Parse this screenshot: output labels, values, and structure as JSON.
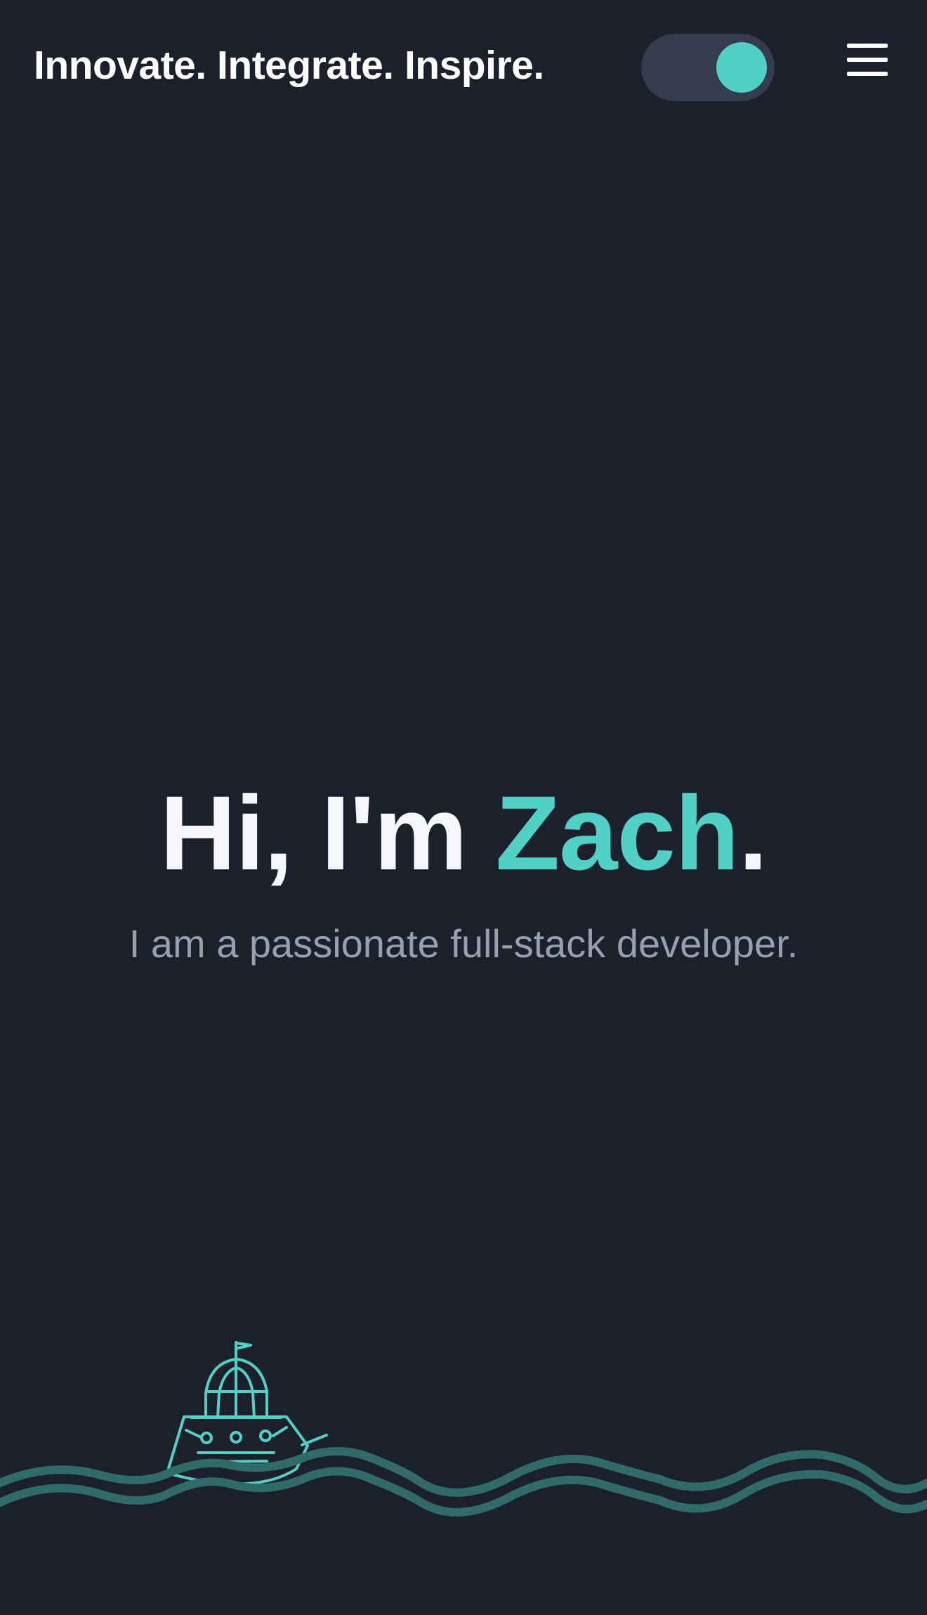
{
  "header": {
    "tagline": "Innovate. Integrate. Inspire.",
    "theme_toggle": {
      "state": "on"
    },
    "menu_icon": "hamburger-menu-icon"
  },
  "hero": {
    "greeting": "Hi, I'm ",
    "name": "Zach",
    "period": ".",
    "subtitle": "I am a passionate full-stack developer."
  },
  "decoration": {
    "boat_icon": "boat-icon",
    "waves": "wave-lines"
  },
  "colors": {
    "background": "#1b202b",
    "accent": "#4fd1c5",
    "toggle_track": "#343c4d",
    "wave": "#2f6b69",
    "subtitle": "#97a0ae"
  }
}
